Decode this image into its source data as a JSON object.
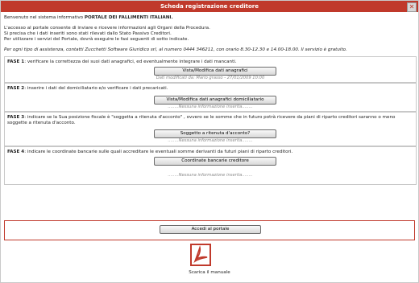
{
  "window": {
    "title": "Scheda registrazione creditore",
    "close_glyph": "✕"
  },
  "intro": {
    "welcome_prefix": "Benvenuto nel sistema informativo ",
    "welcome_bold": "PORTALE DEI FALLIMENTI ITALIANI.",
    "line1": "L'accesso al portale consente di inviare e ricevere informazioni agli Organi della Procedura.",
    "line2": "Si precisa che i dati inseriti sono stati rilevati dallo Stato Passivo Creditori.",
    "line3": "Per utilizzare i servizi del Portale, dovrà eseguire le fasi seguenti di sotto indicate.",
    "assistance": "Per ogni tipo di assistenza, contatti Zucchetti Software Giuridico srl, al numero 0444 346211, con orario 8.30-12.30 e 14.00-18.00. Il servizio è gratuito."
  },
  "steps": [
    {
      "label": "FASE 1",
      "text": ": verificare la correttezza dei suoi dati anagrafici, ed eventualmente integrare i dati mancanti.",
      "button": "Vista/Modifica dati anagrafici",
      "note": "Dati modificati da: Mario grasso - 27/01/2009 10:00"
    },
    {
      "label": "FASE 2",
      "text": ": inserire i dati del domiciliatario e/o verificare i dati precaricati.",
      "button": "Vista/Modifica dati anagrafici domiciliatario",
      "note": "........Nessuna informazione inserita........"
    },
    {
      "label": "FASE 3",
      "text": ": indicare se la Sua posizione fiscale è \"soggetta a ritenuta d'acconto\" , ovvero se le somme che in futuro potrà ricevere da piani di riparto creditori saranno o meno soggette a ritenuta d'acconto.",
      "button": "Soggetto a ritenuta d'acconto?",
      "note": "........Nessuna informazione inserita........"
    },
    {
      "label": "FASE 4",
      "text": ": indicare le coordinate bancarie sulle quali accreditare le eventuali somme derivanti da futuri piani di riparto creditori.",
      "button": "Coordinate bancarie creditore",
      "note": "........Nessuna informazione inserita........"
    }
  ],
  "access_button": "Accedi al portale",
  "manual": {
    "icon": "pdf-icon",
    "label": "Scarica il manuale"
  },
  "colors": {
    "accent": "#c0392b"
  }
}
